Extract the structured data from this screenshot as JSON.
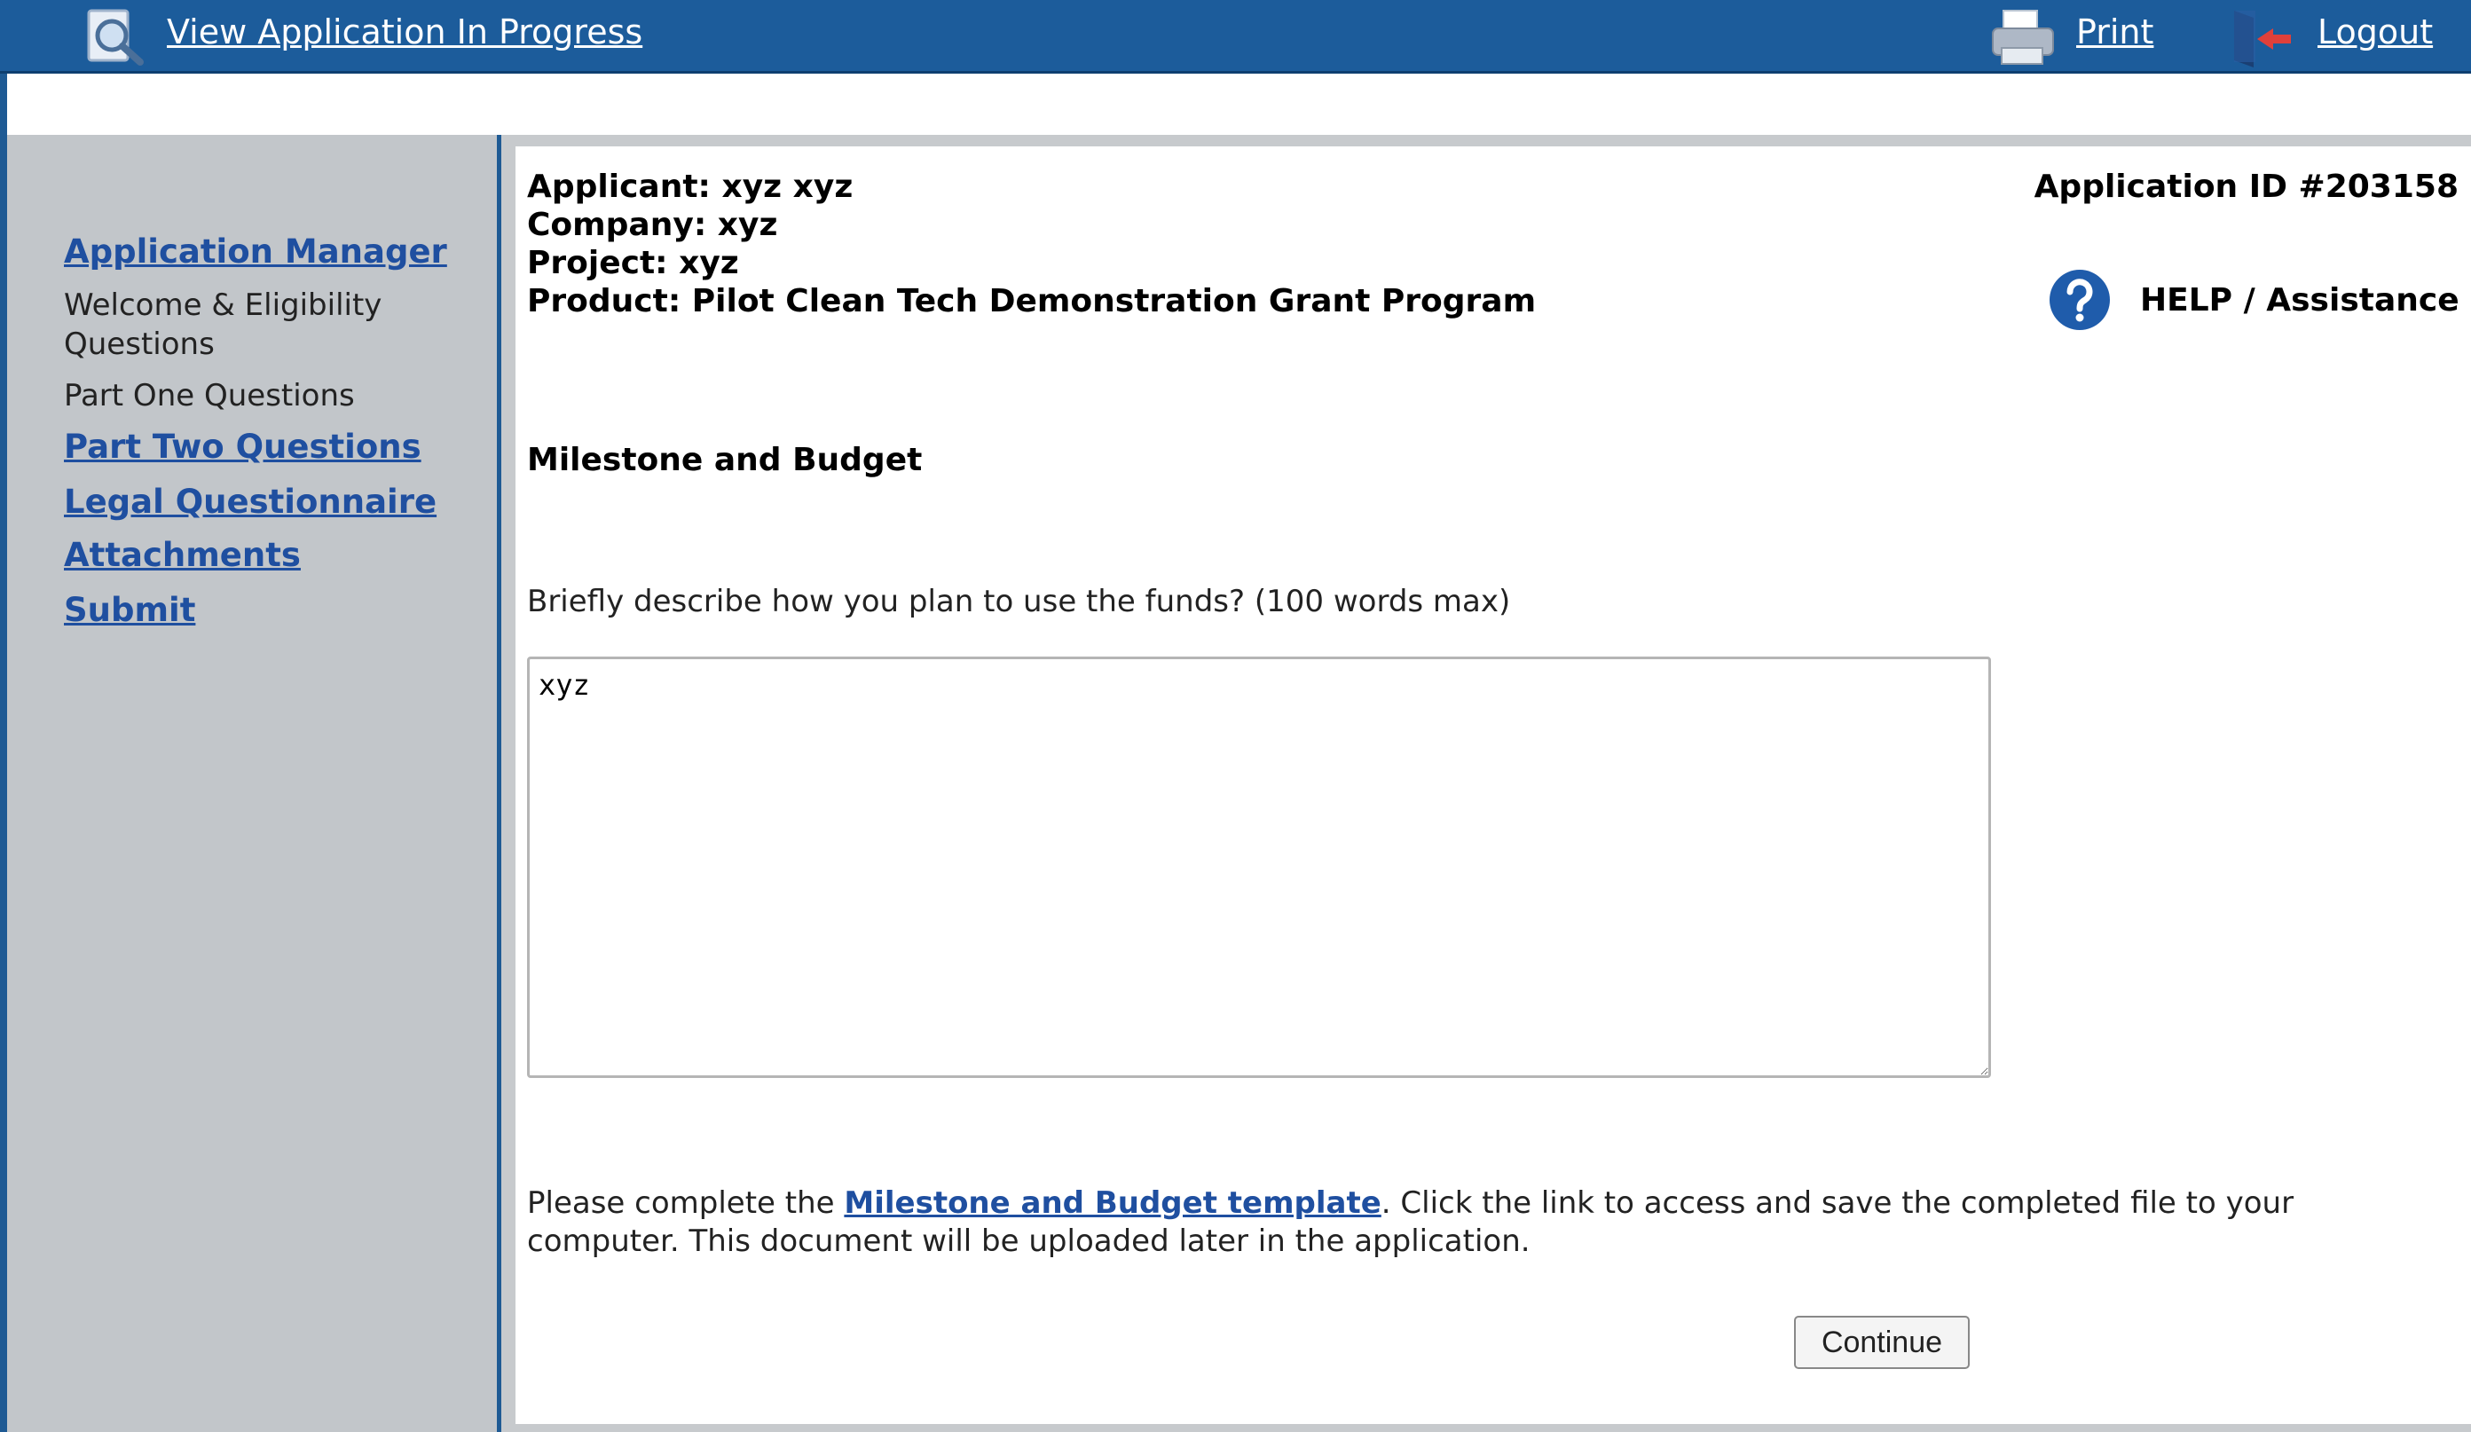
{
  "topbar": {
    "view_label": "View Application In Progress",
    "print_label": "Print",
    "logout_label": "Logout"
  },
  "sidebar": {
    "application_manager": "Application Manager",
    "welcome": "Welcome & Eligibility Questions",
    "part_one": "Part One Questions",
    "part_two": "Part Two Questions",
    "legal": "Legal Questionnaire",
    "attachments": "Attachments",
    "submit": "Submit"
  },
  "header": {
    "applicant": "Applicant: xyz xyz",
    "company": "Company: xyz",
    "project": "Project: xyz",
    "product": "Product: Pilot Clean Tech Demonstration Grant Program",
    "application_id": "Application ID #203158",
    "help_label": "HELP / Assistance"
  },
  "main": {
    "section_title": "Milestone and Budget",
    "question": "Briefly describe how you plan to use the funds? (100 words max)",
    "answer_value": "xyz",
    "instructions_prefix": "Please complete the ",
    "template_link": "Milestone and Budget template",
    "instructions_suffix": ". Click the link to access and save the completed file to your",
    "instructions_line2": "computer. This document will be uploaded later in the application.",
    "continue_label": "Continue"
  },
  "colors": {
    "topbar": "#1c5c9b",
    "sidebar": "#c2c6ca",
    "link": "#1f4fa0"
  }
}
